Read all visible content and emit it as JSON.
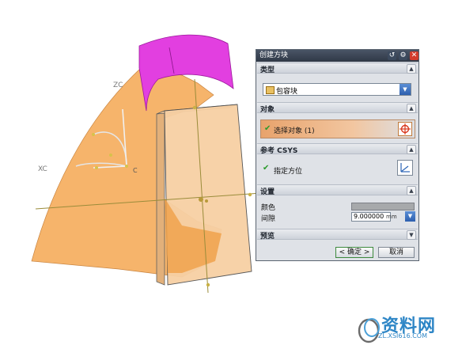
{
  "dialog": {
    "title": "创建方块",
    "sections": {
      "type": "类型",
      "object": "对象",
      "ref": "参考 CSYS",
      "settings": "设置",
      "preview": "预览"
    },
    "type_value": "包容块",
    "select_object": "选择对象 (1)",
    "specify_orientation": "指定方位",
    "color_label": "颜色",
    "gap_label": "间隙",
    "gap_value": "9.000000",
    "gap_unit": "mm",
    "ok": "< 确定 >",
    "cancel": "取消"
  },
  "axes": {
    "zc": "ZC",
    "xc": "XC",
    "yc": "C"
  },
  "watermark": {
    "text": "资料网",
    "url": "ZL.XSI616.COM"
  },
  "colors": {
    "surface_orange": "#f6b46b",
    "block_face": "#f7d0a4",
    "magenta": "#e23fe0",
    "selection_bar": "#e8a36c"
  }
}
